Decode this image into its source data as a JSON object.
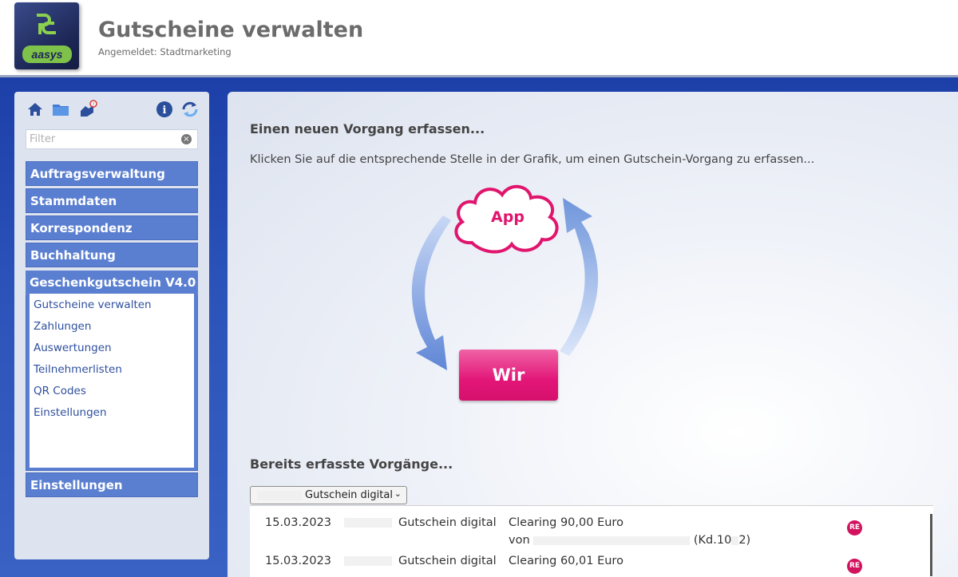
{
  "header": {
    "logo_text": "aasys",
    "title": "Gutscheine verwalten",
    "subtitle": "Angemeldet: Stadtmarketing"
  },
  "sidebar": {
    "filter_placeholder": "Filter",
    "toolbar_icons": [
      "home-icon",
      "folder-icon",
      "help-hand-icon",
      "info-icon",
      "refresh-icon"
    ],
    "menu": [
      {
        "label": "Auftragsverwaltung"
      },
      {
        "label": "Stammdaten"
      },
      {
        "label": "Korrespondenz"
      },
      {
        "label": "Buchhaltung"
      },
      {
        "label": "Geschenkgutschein V4.0"
      },
      {
        "label": "Einstellungen"
      }
    ],
    "submenu": [
      {
        "label": "Gutscheine verwalten"
      },
      {
        "label": "Zahlungen"
      },
      {
        "label": "Auswertungen"
      },
      {
        "label": "Teilnehmerlisten"
      },
      {
        "label": "QR Codes"
      },
      {
        "label": "Einstellungen"
      }
    ]
  },
  "main": {
    "new_heading": "Einen neuen Vorgang erfassen...",
    "intro": "Klicken Sie auf die entsprechende Stelle in der Grafik, um einen Gutschein-Vorgang zu erfassen...",
    "diagram": {
      "app_label": "App",
      "wir_label": "Wir"
    },
    "done_heading": "Bereits erfasste Vorgänge...",
    "filter_select": {
      "value": "Gutschein digital"
    },
    "records": [
      {
        "date": "15.03.2023",
        "type": "Gutschein digital",
        "desc": "Clearing 90,00 Euro",
        "from": "von",
        "customer": "(Kd.10",
        "customer_tail": "2)",
        "badge": "RE"
      },
      {
        "date": "15.03.2023",
        "type": "Gutschein digital",
        "desc": "Clearing 60,01 Euro",
        "from": "",
        "customer": "",
        "customer_tail": "",
        "badge": "RE"
      }
    ]
  },
  "colors": {
    "brand_blue": "#1c3fa8",
    "menu_blue": "#5b7fd0",
    "accent_pink": "#e21678",
    "arrow_blue": "#6f95db"
  }
}
